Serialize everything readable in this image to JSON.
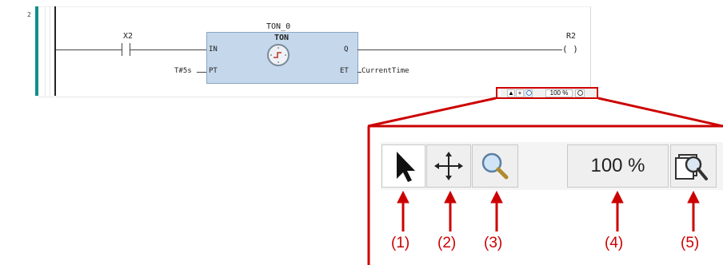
{
  "editor": {
    "row_number": "2",
    "contact": {
      "label": "X2"
    },
    "coil": {
      "label": "R2",
      "symbol": "( )"
    },
    "block": {
      "instance": "TON_0",
      "type": "TON",
      "pin_in": "IN",
      "pin_pt": "PT",
      "pin_q": "Q",
      "pin_et": "ET",
      "pt_value": "T#5s",
      "et_output": "CurrentTime"
    }
  },
  "toolbar": {
    "zoom_value": "100 %",
    "buttons": [
      {
        "label": "(1)",
        "icon": "pointer-icon"
      },
      {
        "label": "(2)",
        "icon": "move-cross-icon"
      },
      {
        "label": "(3)",
        "icon": "magnifier-icon"
      },
      {
        "label": "(4)",
        "icon": "zoom-value"
      },
      {
        "label": "(5)",
        "icon": "zoom-options-icon"
      }
    ]
  },
  "colors": {
    "callout": "#cc0000",
    "block_fill": "#c5d7ea",
    "rung_accent": "#0f8f8b"
  }
}
